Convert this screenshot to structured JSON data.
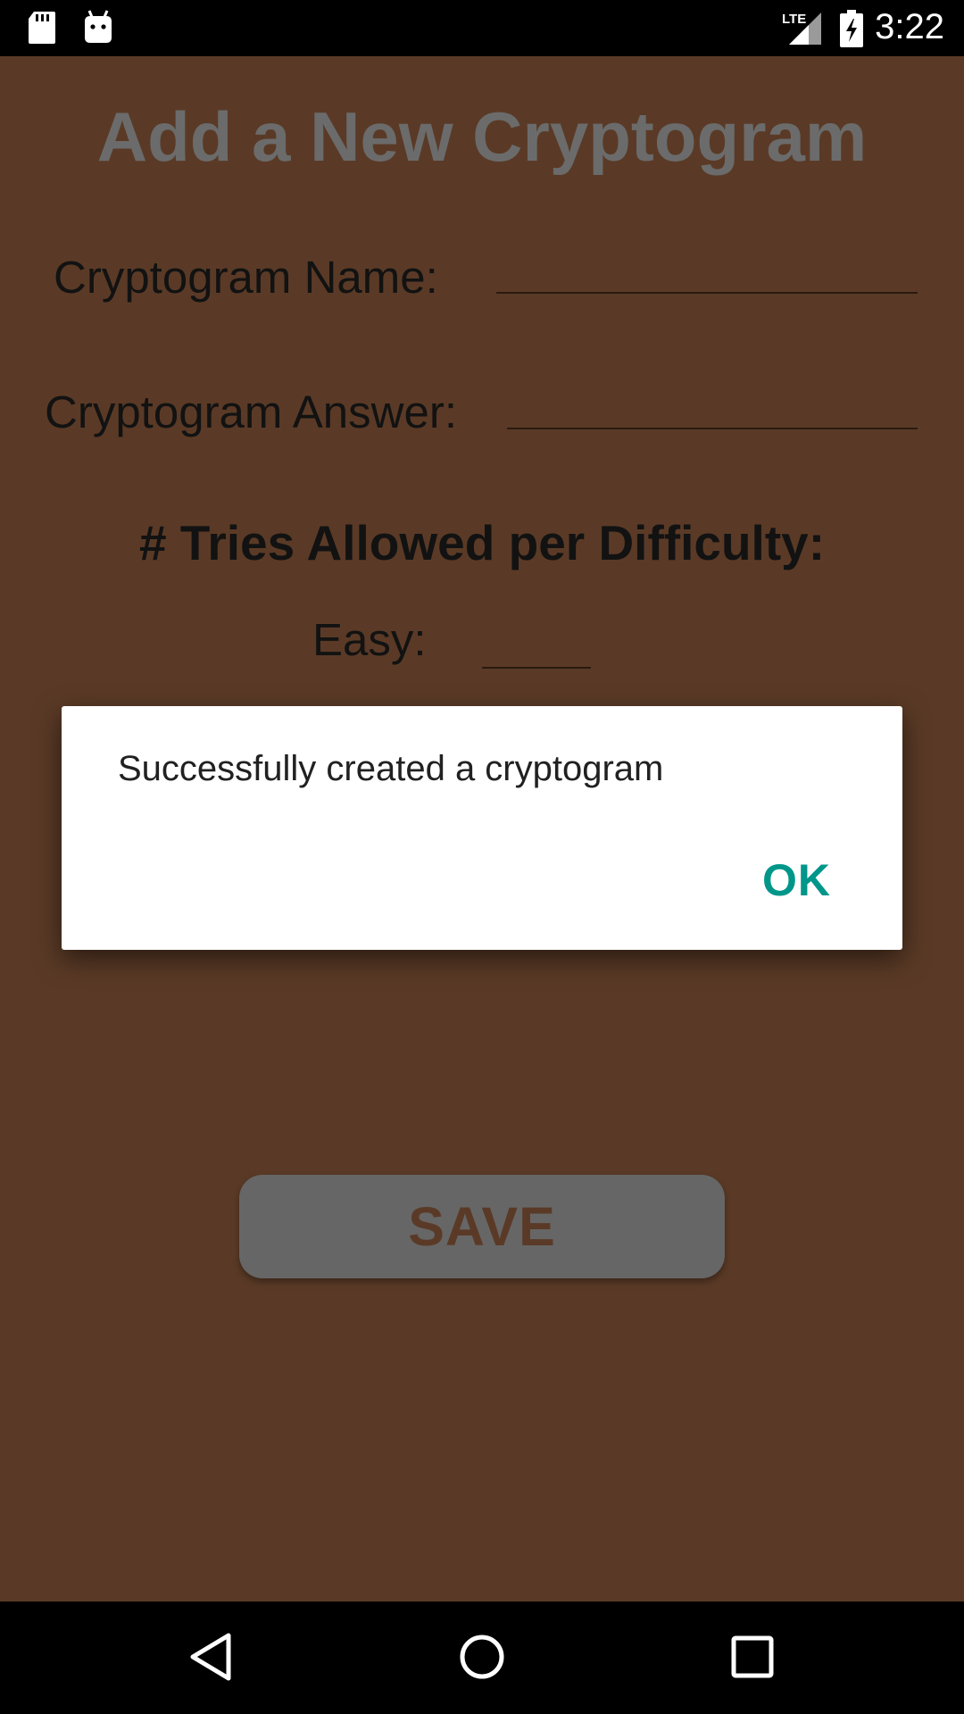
{
  "status_bar": {
    "time": "3:22",
    "network": "LTE",
    "icons": [
      "sd-card-icon",
      "android-debug-icon",
      "lte-signal-icon",
      "battery-charging-icon"
    ]
  },
  "colors": {
    "app_background": "#5a3a26",
    "accent": "#00968a",
    "title_gray": "#6b6b6b",
    "button_gray": "#666666"
  },
  "form": {
    "title": "Add a New Cryptogram",
    "name_label": "Cryptogram Name:",
    "answer_label": "Cryptogram Answer:",
    "tries_heading": "# Tries Allowed per Difficulty:",
    "easy_label": "Easy:",
    "save_label": "SAVE"
  },
  "dialog": {
    "message": "Successfully created a cryptogram",
    "ok_label": "OK"
  },
  "nav_bar": {
    "icons": [
      "back-icon",
      "home-icon",
      "recents-icon"
    ]
  }
}
